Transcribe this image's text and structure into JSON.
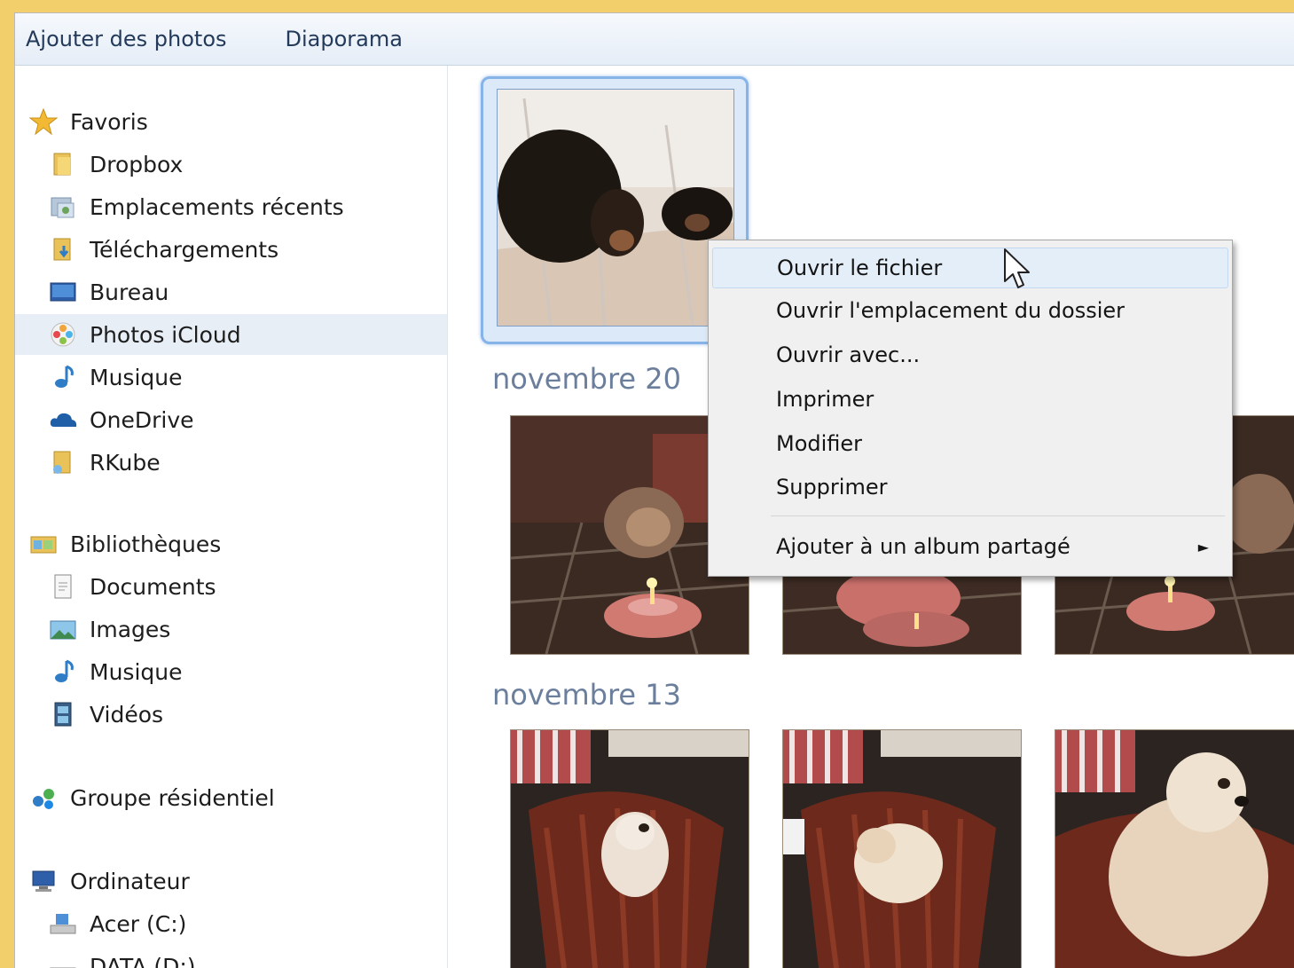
{
  "toolbar": {
    "add_photos_label": "Ajouter des photos",
    "slideshow_label": "Diaporama"
  },
  "sidebar": {
    "favorites": {
      "label": "Favoris",
      "items": [
        {
          "label": "Dropbox",
          "icon": "folder-icon"
        },
        {
          "label": "Emplacements récents",
          "icon": "recent-places-icon"
        },
        {
          "label": "Téléchargements",
          "icon": "downloads-icon"
        },
        {
          "label": "Bureau",
          "icon": "desktop-icon"
        },
        {
          "label": "Photos iCloud",
          "icon": "icloud-photos-icon"
        },
        {
          "label": "Musique",
          "icon": "music-icon"
        },
        {
          "label": "OneDrive",
          "icon": "onedrive-icon"
        },
        {
          "label": "RKube",
          "icon": "folder-icon"
        }
      ]
    },
    "libraries": {
      "label": "Bibliothèques",
      "items": [
        {
          "label": "Documents",
          "icon": "documents-icon"
        },
        {
          "label": "Images",
          "icon": "images-icon"
        },
        {
          "label": "Musique",
          "icon": "music-icon"
        },
        {
          "label": "Vidéos",
          "icon": "videos-icon"
        }
      ]
    },
    "homegroup": {
      "label": "Groupe résidentiel"
    },
    "computer": {
      "label": "Ordinateur",
      "items": [
        {
          "label": "Acer (C:)",
          "icon": "drive-icon"
        },
        {
          "label": "DATA (D:)",
          "icon": "drive-icon"
        }
      ]
    }
  },
  "groups": [
    {
      "title": "novembre 20"
    },
    {
      "title": "novembre 13"
    }
  ],
  "context_menu": {
    "items": [
      {
        "label": "Ouvrir le fichier"
      },
      {
        "label": "Ouvrir l'emplacement du dossier"
      },
      {
        "label": "Ouvrir avec..."
      },
      {
        "label": "Imprimer"
      },
      {
        "label": "Modifier"
      },
      {
        "label": "Supprimer"
      },
      {
        "label": "Ajouter à un album partagé",
        "submenu_arrow": "►"
      }
    ]
  },
  "colors": {
    "desktop_background": "#f3cf6c",
    "selection_border": "#86b4e8",
    "group_title": "#6b7f9c"
  }
}
